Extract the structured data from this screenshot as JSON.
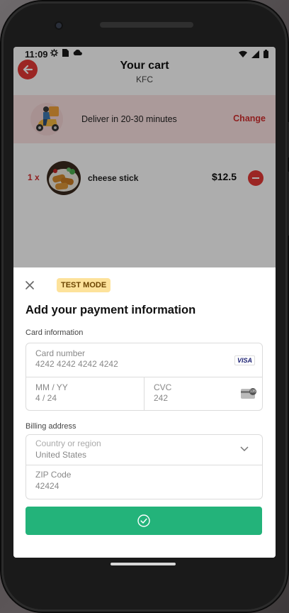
{
  "status_bar": {
    "time": "11:09",
    "left_icons": [
      "gear-icon",
      "sim-card-icon",
      "cloud-icon"
    ],
    "right_icons": [
      "wifi-icon",
      "signal-icon",
      "battery-icon"
    ]
  },
  "cart": {
    "title": "Your cart",
    "restaurant": "KFC",
    "back_icon": "arrow-left-icon",
    "delivery_text": "Deliver in 20-30 minutes",
    "change_label": "Change",
    "items": [
      {
        "quantity": "1 x",
        "name": "cheese stick",
        "price": "$12.5"
      }
    ]
  },
  "payment_sheet": {
    "close_icon": "close-icon",
    "badge": "TEST MODE",
    "title": "Add your payment information",
    "card_section_label": "Card information",
    "card_number_label": "Card number",
    "card_number_value": "4242 4242 4242 4242",
    "card_brand": "VISA",
    "expiry_label": "MM / YY",
    "expiry_value": "4 / 24",
    "cvc_label": "CVC",
    "cvc_value": "242",
    "cvc_badge": "135",
    "billing_section_label": "Billing address",
    "country_label": "Country or region",
    "country_value": "United States",
    "zip_label": "ZIP Code",
    "zip_value": "42424",
    "submit_icon": "check-circle-icon"
  },
  "colors": {
    "accent_red": "#e53935",
    "pay_green": "#23b37a",
    "badge_yellow": "#fde29b",
    "delivery_bg": "#fde3e3"
  }
}
